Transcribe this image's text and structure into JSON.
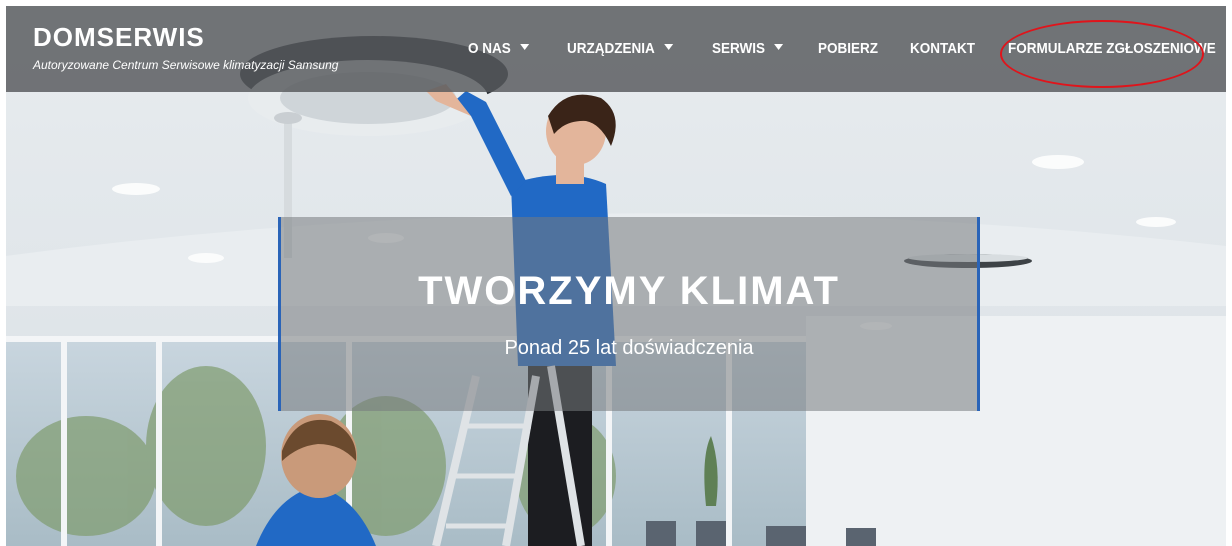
{
  "brand": {
    "title": "DOMSERWIS",
    "subtitle": "Autoryzowane Centrum Serwisowe klimatyzacji Samsung"
  },
  "nav": {
    "items": [
      {
        "label": "O NAS",
        "has_dropdown": true
      },
      {
        "label": "URZĄDZENIA",
        "has_dropdown": true
      },
      {
        "label": "SERWIS",
        "has_dropdown": true
      },
      {
        "label": "POBIERZ",
        "has_dropdown": false
      },
      {
        "label": "KONTAKT",
        "has_dropdown": false
      },
      {
        "label": "FORMULARZE ZGŁOSZENIOWE",
        "has_dropdown": false
      }
    ],
    "highlighted_item": "FORMULARZE ZGŁOSZENIOWE"
  },
  "hero": {
    "title": "TWORZYMY KLIMAT",
    "subtitle": "Ponad 25 lat doświadczenia"
  },
  "colors": {
    "navbar_bg": "#55585c",
    "accent_blue": "#2a64b8",
    "annotation_red": "#e0141b",
    "text": "#ffffff"
  }
}
